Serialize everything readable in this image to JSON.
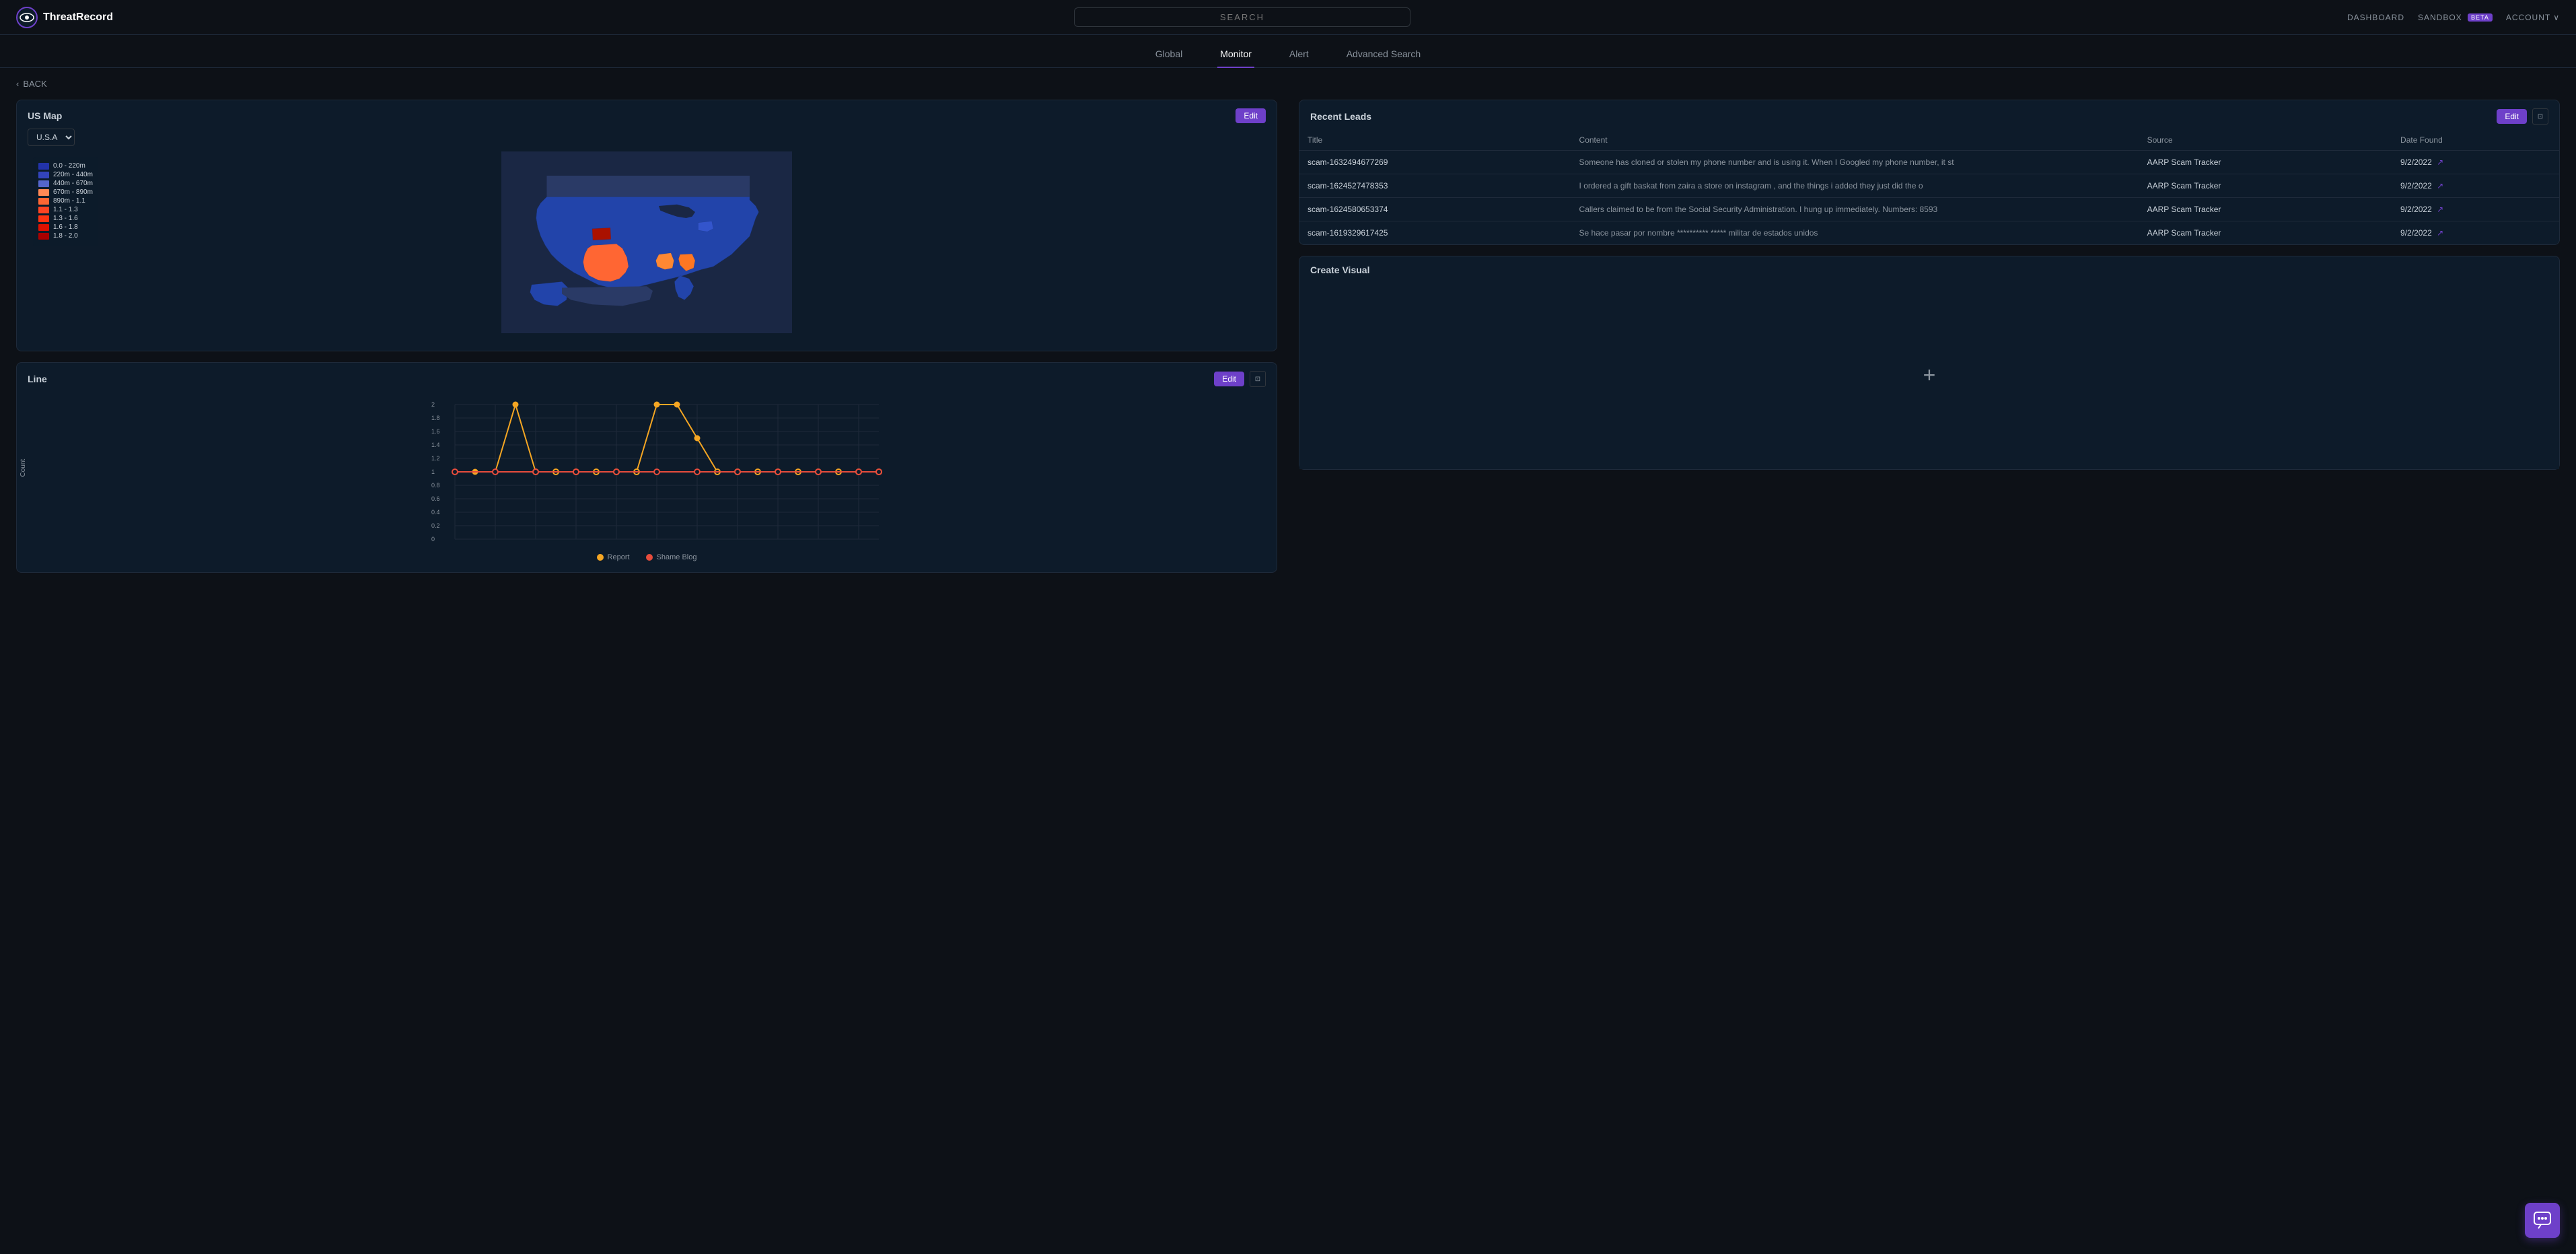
{
  "header": {
    "logo_text": "ThreatRecord",
    "search_placeholder": "SEARCH",
    "nav_items": [
      {
        "label": "DASHBOARD",
        "id": "dashboard"
      },
      {
        "label": "SANDBOX",
        "id": "sandbox",
        "badge": "BETA"
      },
      {
        "label": "ACCOUNT",
        "id": "account",
        "has_arrow": true
      }
    ]
  },
  "tabs": [
    {
      "label": "Global",
      "id": "global",
      "active": false
    },
    {
      "label": "Monitor",
      "id": "monitor",
      "active": true
    },
    {
      "label": "Alert",
      "id": "alert",
      "active": false
    },
    {
      "label": "Advanced Search",
      "id": "advanced-search",
      "active": false
    }
  ],
  "back_label": "BACK",
  "map_section": {
    "title": "US Map",
    "country_select": "U.S.A",
    "edit_label": "Edit",
    "legend": [
      {
        "range": "0.0 - 220m",
        "color": "#2233aa"
      },
      {
        "range": "220m - 440m",
        "color": "#3344bb"
      },
      {
        "range": "440m - 670m",
        "color": "#5566cc"
      },
      {
        "range": "670m - 890m",
        "color": "#ff6633"
      },
      {
        "range": "890m - 1.1",
        "color": "#ff4422"
      },
      {
        "range": "1.1 - 1.3",
        "color": "#ff3311"
      },
      {
        "range": "1.3 - 1.6",
        "color": "#ff2200"
      },
      {
        "range": "1.6 - 1.8",
        "color": "#dd1100"
      },
      {
        "range": "1.8 - 2.0",
        "color": "#aa0000"
      }
    ]
  },
  "line_chart": {
    "title": "Line",
    "edit_label": "Edit",
    "y_axis_label": "Count",
    "y_values": [
      "2",
      "1.8",
      "1.6",
      "1.4",
      "1.2",
      "1",
      "0.8",
      "0.6",
      "0.4",
      "0.2",
      "0"
    ],
    "legend": [
      {
        "label": "Report",
        "color": "#f5a623"
      },
      {
        "label": "Shame Blog",
        "color": "#e74c3c"
      }
    ]
  },
  "recent_leads": {
    "title": "Recent Leads",
    "edit_label": "Edit",
    "columns": [
      "Title",
      "Content",
      "Source",
      "Date Found"
    ],
    "rows": [
      {
        "title": "scam-1632494677269",
        "content": "Someone has cloned or stolen my phone number and is using it. When I Googled my phone number, it st",
        "source": "AARP Scam Tracker",
        "date": "9/2/2022"
      },
      {
        "title": "scam-1624527478353",
        "content": "I ordered a gift baskat from zaira a store on instagram , and the things i added they just did the o",
        "source": "AARP Scam Tracker",
        "date": "9/2/2022"
      },
      {
        "title": "scam-1624580653374",
        "content": "Callers claimed to be from the Social Security Administration. I hung up immediately. Numbers: 8593",
        "source": "AARP Scam Tracker",
        "date": "9/2/2022"
      },
      {
        "title": "scam-1619329617425",
        "content": "Se hace pasar por nombre ********** ***** militar de estados unidos",
        "source": "AARP Scam Tracker",
        "date": "9/2/2022"
      }
    ]
  },
  "create_visual": {
    "title": "Create Visual",
    "plus_icon": "+"
  },
  "chat_fab_icon": "💬"
}
